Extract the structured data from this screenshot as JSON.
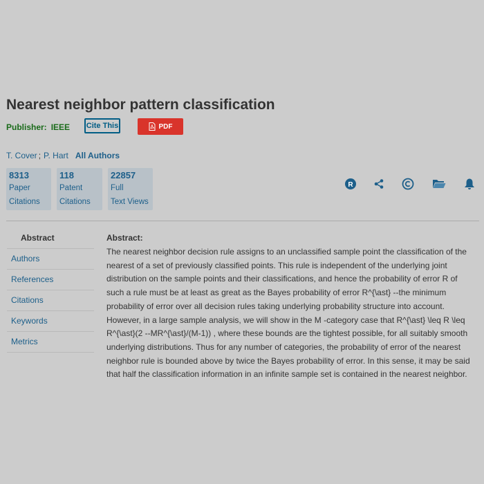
{
  "document": {
    "title": "Nearest neighbor pattern classification",
    "publisher_label": "Publisher:",
    "publisher_value": "IEEE",
    "cite_button": "Cite This",
    "pdf_button": "PDF"
  },
  "authors": {
    "list": [
      "T. Cover",
      "P. Hart"
    ],
    "separator": ";",
    "all_authors_label": "All Authors"
  },
  "metrics": [
    {
      "value": "8313",
      "line1": "Paper",
      "line2": "Citations"
    },
    {
      "value": "118",
      "line1": "Patent",
      "line2": "Citations"
    },
    {
      "value": "22857",
      "line1": "Full",
      "line2": "Text Views"
    }
  ],
  "action_icons": [
    "r-icon",
    "share-icon",
    "copyright-icon",
    "folder-icon",
    "bell-icon"
  ],
  "sidenav": {
    "items": [
      "Abstract",
      "Authors",
      "References",
      "Citations",
      "Keywords",
      "Metrics"
    ],
    "active": "Abstract"
  },
  "abstract": {
    "heading": "Abstract:",
    "text": "The nearest neighbor decision rule assigns to an unclassified sample point the classification of the nearest of a set of previously classified points. This rule is independent of the underlying joint distribution on the sample points and their classifications, and hence the probability of error R of such a rule must be at least as great as the Bayes probability of error R^{\\ast} --the minimum probability of error over all decision rules taking underlying probability structure into account. However, in a large sample analysis, we will show in the M -category case that R^{\\ast} \\leq R \\leq R^{\\ast}(2 --MR^{\\ast}/(M-1)) , where these bounds are the tightest possible, for all suitably smooth underlying distributions. Thus for any number of categories, the probability of error of the nearest neighbor rule is bounded above by twice the Bayes probability of error. In this sense, it may be said that half the classification information in an infinite sample set is contained in the nearest neighbor."
  },
  "colors": {
    "background": "#cccccc",
    "link": "#1d5f8a",
    "publisher": "#1a6b1a",
    "pdf_button": "#d9342b",
    "metric_box": "#b8c1c8"
  }
}
